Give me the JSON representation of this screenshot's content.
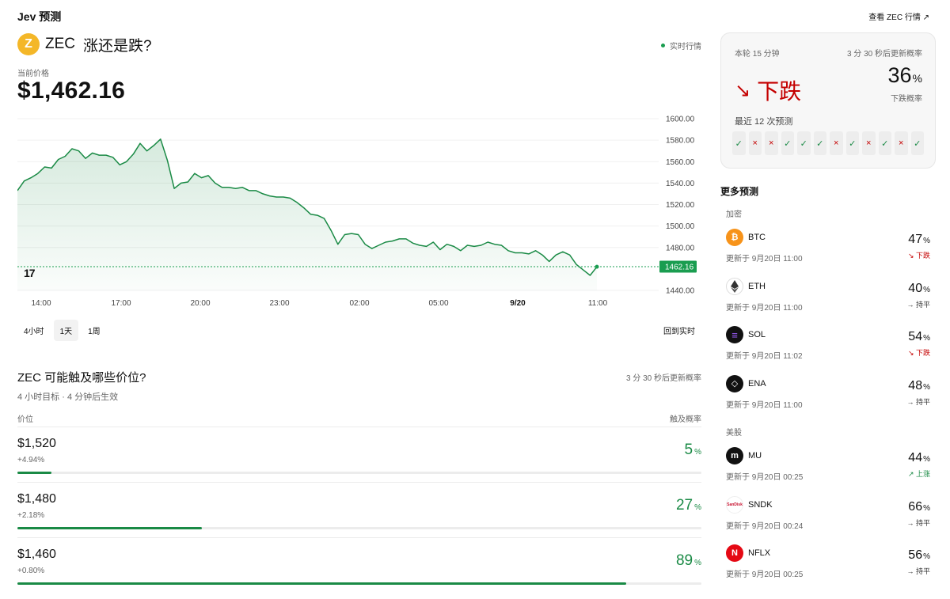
{
  "app": {
    "title": "Jev 预测",
    "market_link": "查看 ZEC 行情 ↗"
  },
  "coin": {
    "symbol": "ZEC",
    "question": "涨还是跌?",
    "logo_glyph": "Z",
    "logo_color": "#f4b728"
  },
  "status": {
    "live_label": "实时行情"
  },
  "price": {
    "label": "当前价格",
    "value": "$1,462.16"
  },
  "chart_data": {
    "type": "area",
    "y_ticks": [
      "1600.00",
      "1580.00",
      "1560.00",
      "1540.00",
      "1520.00",
      "1500.00",
      "1480.00",
      "1440.00"
    ],
    "ylim": [
      1440,
      1600
    ],
    "x_ticks": [
      "14:00",
      "17:00",
      "20:00",
      "23:00",
      "02:00",
      "05:00",
      "9/20",
      "11:00"
    ],
    "current_label": "1462.16",
    "current_value": 1462.16,
    "series": [
      {
        "values": [
          1533,
          1542,
          1545,
          1549,
          1555,
          1554,
          1562,
          1565,
          1572,
          1570,
          1563,
          1568,
          1566,
          1566,
          1564,
          1557,
          1560,
          1567,
          1577,
          1570,
          1575,
          1581,
          1561,
          1535,
          1540,
          1541,
          1549,
          1545,
          1547,
          1540,
          1536,
          1536,
          1535,
          1536,
          1533,
          1533,
          1530,
          1528,
          1527,
          1527,
          1526,
          1522,
          1517,
          1511,
          1510,
          1507,
          1496,
          1483,
          1492,
          1493,
          1492,
          1483,
          1479,
          1482,
          1485,
          1486,
          1488,
          1488,
          1484,
          1482,
          1481,
          1485,
          1478,
          1483,
          1481,
          1477,
          1482,
          1481,
          1482,
          1485,
          1483,
          1482,
          1477,
          1475,
          1475,
          1474,
          1477,
          1473,
          1467,
          1473,
          1476,
          1473,
          1464,
          1459,
          1454,
          1462
        ]
      }
    ],
    "line_color": "#1a8a45",
    "current_color": "#1a9d50",
    "watermark": "17"
  },
  "ranges": {
    "items": [
      "4小时",
      "1天",
      "1周"
    ],
    "active": 1,
    "back_live": "回到实时"
  },
  "targets": {
    "title": "ZEC 可能触及哪些价位?",
    "update": "3 分 30 秒后更新概率",
    "subtitle": "4 小时目标 · 4 分钟后生效",
    "col_price": "价位",
    "col_prob": "触及概率",
    "items": [
      {
        "price": "$1,520",
        "change": "+4.94%",
        "prob": "5",
        "pct": 0.05
      },
      {
        "price": "$1,480",
        "change": "+2.18%",
        "prob": "27",
        "pct": 0.27
      },
      {
        "price": "$1,460",
        "change": "+0.80%",
        "prob": "89",
        "pct": 0.89
      }
    ]
  },
  "card": {
    "round": "本轮 15 分钟",
    "update": "3 分 30 秒后更新概率",
    "direction_arrow": "↘",
    "direction": "下跌",
    "prob": "36",
    "prob_label": "下跌概率",
    "recent_label": "最近 12 次预测",
    "marks": [
      "ok",
      "bad",
      "bad",
      "ok",
      "ok",
      "ok",
      "bad",
      "ok",
      "bad",
      "ok",
      "bad",
      "ok"
    ]
  },
  "more": {
    "title": "更多预测",
    "categories": [
      {
        "label": "加密",
        "items": [
          {
            "symbol": "BTC",
            "updated": "更新于 9月20日 11:00",
            "prob": "47",
            "dir": "↘ 下跌",
            "dir_type": "down",
            "logo_color": "#f7931a",
            "logo_glyph": "₿"
          },
          {
            "symbol": "ETH",
            "updated": "更新于 9月20日 11:00",
            "prob": "40",
            "dir": "→ 持平",
            "dir_type": "flat",
            "logo_color": "#ffffff",
            "logo_glyph": ""
          },
          {
            "symbol": "SOL",
            "updated": "更新于 9月20日 11:02",
            "prob": "54",
            "dir": "↘ 下跌",
            "dir_type": "down",
            "logo_color": "#111111",
            "logo_glyph": "≡"
          },
          {
            "symbol": "ENA",
            "updated": "更新于 9月20日 11:00",
            "prob": "48",
            "dir": "→ 持平",
            "dir_type": "flat",
            "logo_color": "#111111",
            "logo_glyph": "◇"
          }
        ]
      },
      {
        "label": "美股",
        "items": [
          {
            "symbol": "MU",
            "updated": "更新于 9月20日 00:25",
            "prob": "44",
            "dir": "↗ 上涨",
            "dir_type": "up",
            "logo_color": "#111111",
            "logo_glyph": "m"
          },
          {
            "symbol": "SNDK",
            "updated": "更新于 9月20日 00:24",
            "prob": "66",
            "dir": "→ 持平",
            "dir_type": "flat",
            "logo_color": "#ffffff",
            "logo_glyph": "SanDisk"
          },
          {
            "symbol": "NFLX",
            "updated": "更新于 9月20日 00:25",
            "prob": "56",
            "dir": "→ 持平",
            "dir_type": "flat",
            "logo_color": "#e50914",
            "logo_glyph": "N"
          }
        ]
      }
    ]
  }
}
